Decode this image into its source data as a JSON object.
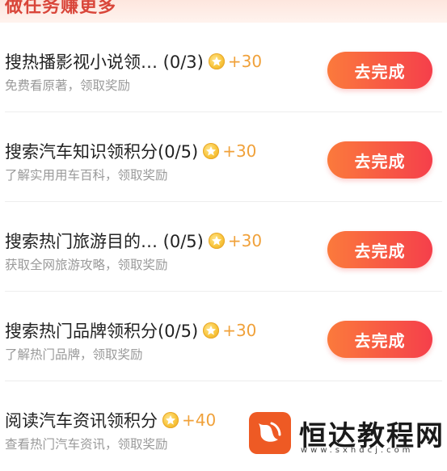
{
  "section": {
    "title": "做任务赚更多"
  },
  "tasks": [
    {
      "title": "搜热播影视小说领… (0/3)",
      "reward": "+30",
      "desc": "免费看原著，领取奖励",
      "button": "去完成"
    },
    {
      "title": "搜索汽车知识领积分(0/5)",
      "reward": "+30",
      "desc": "了解实用用车百科，领取奖励",
      "button": "去完成"
    },
    {
      "title": "搜索热门旅游目的… (0/5)",
      "reward": "+30",
      "desc": "获取全网旅游攻略，领取奖励",
      "button": "去完成"
    },
    {
      "title": "搜索热门品牌领积分(0/5)",
      "reward": "+30",
      "desc": "了解热门品牌，领取奖励",
      "button": "去完成"
    },
    {
      "title": "阅读汽车资讯领积分",
      "reward": "+40",
      "desc": "查看热门汽车资讯，领取奖励",
      "button": ""
    }
  ],
  "watermark": {
    "text": "恒达教程网",
    "url": "www.sxhdcj.com",
    "icon": "fish-logo-icon"
  },
  "colors": {
    "accent_start": "#fb7a3c",
    "accent_end": "#f53f4b",
    "reward": "#f0a13a",
    "title_red": "#d9463a"
  }
}
